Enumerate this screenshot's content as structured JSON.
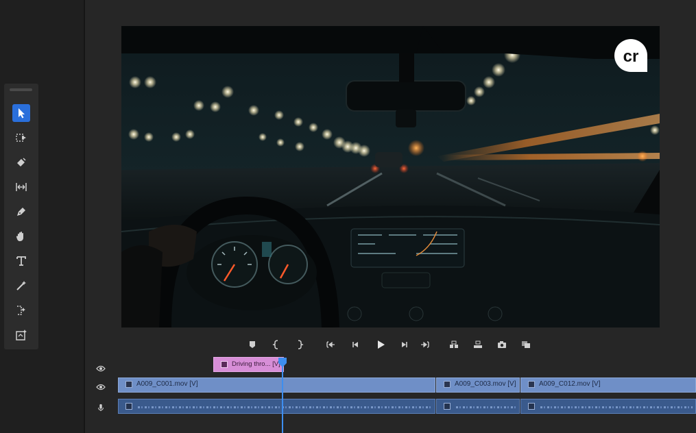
{
  "tools": [
    {
      "name": "selection-tool",
      "icon": "arrow-pointer-icon",
      "active": true
    },
    {
      "name": "track-select-tool",
      "icon": "track-select-forward-icon",
      "active": false
    },
    {
      "name": "ripple-edit-tool",
      "icon": "ripple-edit-icon",
      "active": false
    },
    {
      "name": "slip-tool",
      "icon": "slip-icon",
      "active": false
    },
    {
      "name": "pen-tool",
      "icon": "pen-icon",
      "active": false
    },
    {
      "name": "hand-tool",
      "icon": "hand-icon",
      "active": false
    },
    {
      "name": "type-tool",
      "icon": "type-icon",
      "active": false
    },
    {
      "name": "magic-wand-tool",
      "icon": "magic-wand-icon",
      "active": false
    },
    {
      "name": "generative-extend-tool",
      "icon": "generative-extend-icon",
      "active": false
    },
    {
      "name": "frame-hold-tool",
      "icon": "frame-icon",
      "active": false
    }
  ],
  "transport": [
    "add-marker-icon",
    "mark-in-icon",
    "mark-out-icon",
    "go-to-in-icon",
    "step-back-icon",
    "play-icon",
    "step-forward-icon",
    "go-to-out-icon",
    "lift-icon",
    "extract-icon",
    "export-frame-icon",
    "compare-view-icon"
  ],
  "logo_text": "cr",
  "timeline": {
    "graphics_clip": {
      "label": "Driving thro... [V]"
    },
    "video_clips": [
      {
        "label": "A009_C001.mov [V]"
      },
      {
        "label": "A009_C003.mov [V]"
      },
      {
        "label": "A009_C012.mov [V]"
      }
    ],
    "audio_clips": 3
  },
  "colors": {
    "accent": "#2a6fdb",
    "video_clip": "#6f8fc7",
    "audio_clip": "#3a5a8c",
    "graphics_clip": "#d78ed7",
    "playhead": "#3d8ef0"
  }
}
